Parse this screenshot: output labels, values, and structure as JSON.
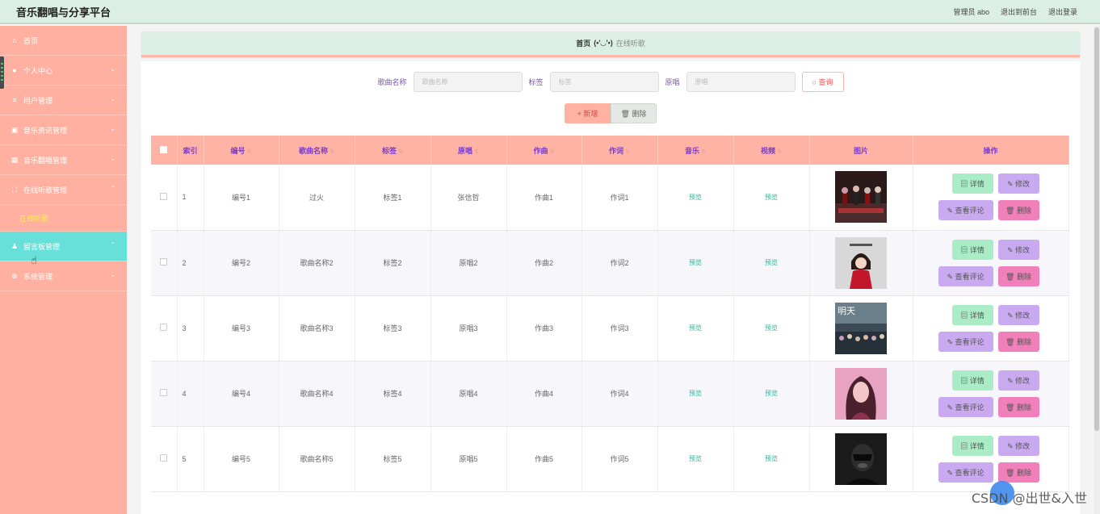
{
  "app": {
    "title": "音乐翻唱与分享平台"
  },
  "topbar": {
    "user": "管理员 abo",
    "to_front": "退出到前台",
    "logout": "退出登录"
  },
  "sidebar": {
    "items": [
      {
        "label": "首页",
        "icon": "home-icon"
      },
      {
        "label": "个人中心",
        "icon": "user-icon"
      },
      {
        "label": "用户管理",
        "icon": "list-icon"
      },
      {
        "label": "音乐资讯管理",
        "icon": "video-icon"
      },
      {
        "label": "音乐翻唱管理",
        "icon": "grid-icon"
      },
      {
        "label": "在线听歌管理",
        "icon": "bracket-icon"
      },
      {
        "label": "留言板管理",
        "icon": "person-icon"
      },
      {
        "label": "系统管理",
        "icon": "settings-icon"
      }
    ],
    "sub": "在线听歌"
  },
  "breadcrumb": {
    "home": "首页",
    "face": "(•'◡'•)",
    "current": "在线听歌"
  },
  "search": {
    "song_label": "歌曲名称",
    "song_placeholder": "歌曲名称",
    "tag_label": "标签",
    "tag_placeholder": "标签",
    "orig_label": "原唱",
    "orig_placeholder": "原唱",
    "button": "查询"
  },
  "actions": {
    "add": "+ 新增",
    "delete": "删除"
  },
  "table": {
    "headers": {
      "index": "索引",
      "code": "编号",
      "song": "歌曲名称",
      "tag": "标签",
      "orig": "原唱",
      "composer": "作曲",
      "lyricist": "作词",
      "music": "音乐",
      "video": "视频",
      "image": "图片",
      "ops": "操作"
    },
    "preview": "预览",
    "op_labels": {
      "detail": "详情",
      "edit": "修改",
      "comments": "查看评论",
      "delete": "删除"
    },
    "rows": [
      {
        "index": "1",
        "code": "编号1",
        "song": "过火",
        "tag": "标签1",
        "orig": "张信哲",
        "composer": "作曲1",
        "lyricist": "作词1",
        "thumb": "band-photo"
      },
      {
        "index": "2",
        "code": "编号2",
        "song": "歌曲名称2",
        "tag": "标签2",
        "orig": "原唱2",
        "composer": "作曲2",
        "lyricist": "作词2",
        "thumb": "girl-red-dress"
      },
      {
        "index": "3",
        "code": "编号3",
        "song": "歌曲名称3",
        "tag": "标签3",
        "orig": "原唱3",
        "composer": "作曲3",
        "lyricist": "作词3",
        "thumb": "crowd-poster"
      },
      {
        "index": "4",
        "code": "编号4",
        "song": "歌曲名称4",
        "tag": "标签4",
        "orig": "原唱4",
        "composer": "作曲4",
        "lyricist": "作词4",
        "thumb": "pink-portrait"
      },
      {
        "index": "5",
        "code": "编号5",
        "song": "歌曲名称5",
        "tag": "标签5",
        "orig": "原唱5",
        "composer": "作曲5",
        "lyricist": "作词5",
        "thumb": "dark-portrait"
      }
    ]
  },
  "watermark": "CSDN @出世&入世",
  "colors": {
    "sidebar": "#ffb0a0",
    "active": "#66e0d8",
    "header": "#ffb3a4",
    "topbar": "#dcefe6"
  }
}
